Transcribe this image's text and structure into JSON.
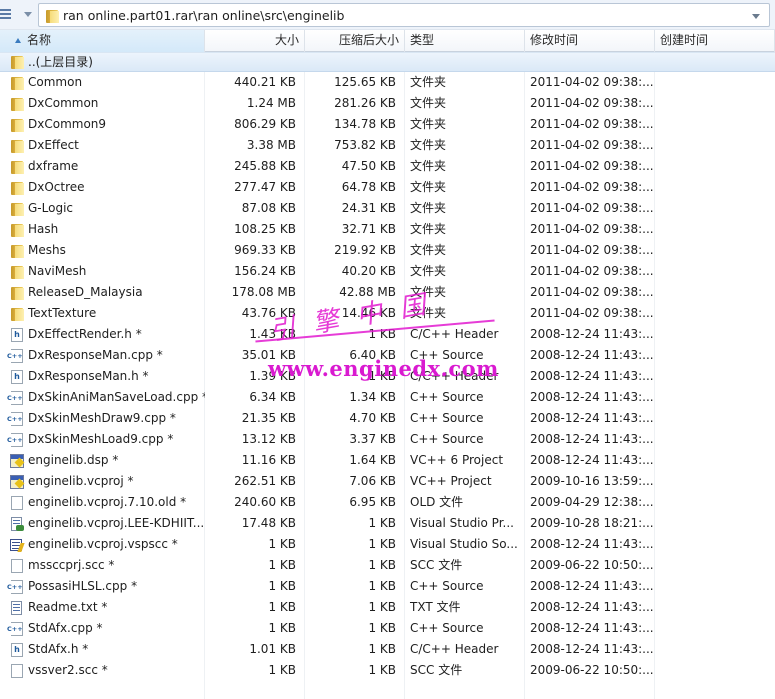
{
  "toolbar": {
    "menu_icon": "hamburger-menu-icon",
    "path": "ran online.part01.rar\\ran online\\src\\enginelib"
  },
  "columns": {
    "name": "名称",
    "size": "大小",
    "packed": "压缩后大小",
    "type": "类型",
    "modified": "修改时间",
    "created": "创建时间",
    "sorted_by": "name"
  },
  "parent_row": {
    "label": "..(上层目录)",
    "icon": "folder-icon"
  },
  "files": [
    {
      "name": "Common",
      "icon": "folder",
      "size": "440.21 KB",
      "packed": "125.65 KB",
      "type": "文件夹",
      "modified": "2011-04-02 09:38:...",
      "created": ""
    },
    {
      "name": "DxCommon",
      "icon": "folder",
      "size": "1.24 MB",
      "packed": "281.26 KB",
      "type": "文件夹",
      "modified": "2011-04-02 09:38:...",
      "created": ""
    },
    {
      "name": "DxCommon9",
      "icon": "folder",
      "size": "806.29 KB",
      "packed": "134.78 KB",
      "type": "文件夹",
      "modified": "2011-04-02 09:38:...",
      "created": ""
    },
    {
      "name": "DxEffect",
      "icon": "folder",
      "size": "3.38 MB",
      "packed": "753.82 KB",
      "type": "文件夹",
      "modified": "2011-04-02 09:38:...",
      "created": ""
    },
    {
      "name": "dxframe",
      "icon": "folder",
      "size": "245.88 KB",
      "packed": "47.50 KB",
      "type": "文件夹",
      "modified": "2011-04-02 09:38:...",
      "created": ""
    },
    {
      "name": "DxOctree",
      "icon": "folder",
      "size": "277.47 KB",
      "packed": "64.78 KB",
      "type": "文件夹",
      "modified": "2011-04-02 09:38:...",
      "created": ""
    },
    {
      "name": "G-Logic",
      "icon": "folder",
      "size": "87.08 KB",
      "packed": "24.31 KB",
      "type": "文件夹",
      "modified": "2011-04-02 09:38:...",
      "created": ""
    },
    {
      "name": "Hash",
      "icon": "folder",
      "size": "108.25 KB",
      "packed": "32.71 KB",
      "type": "文件夹",
      "modified": "2011-04-02 09:38:...",
      "created": ""
    },
    {
      "name": "Meshs",
      "icon": "folder",
      "size": "969.33 KB",
      "packed": "219.92 KB",
      "type": "文件夹",
      "modified": "2011-04-02 09:38:...",
      "created": ""
    },
    {
      "name": "NaviMesh",
      "icon": "folder",
      "size": "156.24 KB",
      "packed": "40.20 KB",
      "type": "文件夹",
      "modified": "2011-04-02 09:38:...",
      "created": ""
    },
    {
      "name": "ReleaseD_Malaysia",
      "icon": "folder",
      "size": "178.08 MB",
      "packed": "42.88 MB",
      "type": "文件夹",
      "modified": "2011-04-02 09:38:...",
      "created": ""
    },
    {
      "name": "TextTexture",
      "icon": "folder",
      "size": "43.76 KB",
      "packed": "14.46 KB",
      "type": "文件夹",
      "modified": "2011-04-02 09:38:...",
      "created": ""
    },
    {
      "name": "DxEffectRender.h *",
      "icon": "h",
      "size": "1.43 KB",
      "packed": "1 KB",
      "type": "C/C++ Header",
      "modified": "2008-12-24 11:43:...",
      "created": ""
    },
    {
      "name": "DxResponseMan.cpp *",
      "icon": "cpp",
      "size": "35.01 KB",
      "packed": "6.40 KB",
      "type": "C++ Source",
      "modified": "2008-12-24 11:43:...",
      "created": ""
    },
    {
      "name": "DxResponseMan.h *",
      "icon": "h",
      "size": "1.39 KB",
      "packed": "1 KB",
      "type": "C/C++ Header",
      "modified": "2008-12-24 11:43:...",
      "created": ""
    },
    {
      "name": "DxSkinAniManSaveLoad.cpp *",
      "icon": "cpp",
      "size": "6.34 KB",
      "packed": "1.34 KB",
      "type": "C++ Source",
      "modified": "2008-12-24 11:43:...",
      "created": ""
    },
    {
      "name": "DxSkinMeshDraw9.cpp *",
      "icon": "cpp",
      "size": "21.35 KB",
      "packed": "4.70 KB",
      "type": "C++ Source",
      "modified": "2008-12-24 11:43:...",
      "created": ""
    },
    {
      "name": "DxSkinMeshLoad9.cpp *",
      "icon": "cpp",
      "size": "13.12 KB",
      "packed": "3.37 KB",
      "type": "C++ Source",
      "modified": "2008-12-24 11:43:...",
      "created": ""
    },
    {
      "name": "enginelib.dsp *",
      "icon": "proj",
      "size": "11.16 KB",
      "packed": "1.64 KB",
      "type": "VC++ 6 Project",
      "modified": "2008-12-24 11:43:...",
      "created": ""
    },
    {
      "name": "enginelib.vcproj *",
      "icon": "proj",
      "size": "262.51 KB",
      "packed": "7.06 KB",
      "type": "VC++ Project",
      "modified": "2009-10-16 13:59:...",
      "created": ""
    },
    {
      "name": "enginelib.vcproj.7.10.old *",
      "icon": "blank",
      "size": "240.60 KB",
      "packed": "6.95 KB",
      "type": "OLD 文件",
      "modified": "2009-04-29 12:38:...",
      "created": ""
    },
    {
      "name": "enginelib.vcproj.LEE-KDHIIT...",
      "icon": "vsp",
      "size": "17.48 KB",
      "packed": "1 KB",
      "type": "Visual Studio Pr...",
      "modified": "2009-10-28 18:21:...",
      "created": ""
    },
    {
      "name": "enginelib.vcproj.vspscc *",
      "icon": "vss",
      "size": "1 KB",
      "packed": "1 KB",
      "type": "Visual Studio So...",
      "modified": "2008-12-24 11:43:...",
      "created": ""
    },
    {
      "name": "mssccprj.scc *",
      "icon": "blank",
      "size": "1 KB",
      "packed": "1 KB",
      "type": "SCC 文件",
      "modified": "2009-06-22 10:50:...",
      "created": ""
    },
    {
      "name": "PossasiHLSL.cpp *",
      "icon": "cpp",
      "size": "1 KB",
      "packed": "1 KB",
      "type": "C++ Source",
      "modified": "2008-12-24 11:43:...",
      "created": ""
    },
    {
      "name": "Readme.txt *",
      "icon": "txt",
      "size": "1 KB",
      "packed": "1 KB",
      "type": "TXT 文件",
      "modified": "2008-12-24 11:43:...",
      "created": ""
    },
    {
      "name": "StdAfx.cpp *",
      "icon": "cpp",
      "size": "1 KB",
      "packed": "1 KB",
      "type": "C++ Source",
      "modified": "2008-12-24 11:43:...",
      "created": ""
    },
    {
      "name": "StdAfx.h *",
      "icon": "h",
      "size": "1.01 KB",
      "packed": "1 KB",
      "type": "C/C++ Header",
      "modified": "2008-12-24 11:43:...",
      "created": ""
    },
    {
      "name": "vssver2.scc *",
      "icon": "blank",
      "size": "1 KB",
      "packed": "1 KB",
      "type": "SCC 文件",
      "modified": "2009-06-22 10:50:...",
      "created": ""
    }
  ],
  "watermark": {
    "chinese": "引擎中国",
    "url": "www.enginedx.com",
    "color": "#e21ad0"
  },
  "colors": {
    "header_sorted": "#d4e9f9",
    "parent_row": "#dbe9f7",
    "folder": "#f0cf5c",
    "accent": "#3a7bbf"
  }
}
